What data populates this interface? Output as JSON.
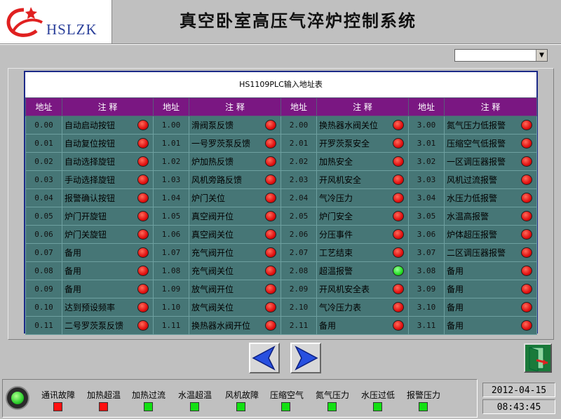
{
  "header": {
    "logo_text": "HSLZK",
    "title": "真空卧室高压气淬炉控制系统"
  },
  "dropdown": {
    "value": ""
  },
  "table": {
    "title": "HS1109PLC输入地址表",
    "headers": {
      "addr": "地址",
      "note": "注  释"
    },
    "columns": [
      [
        {
          "addr": "0.00",
          "note": "自动启动按钮",
          "state": "red"
        },
        {
          "addr": "0.01",
          "note": "自动复位按钮",
          "state": "red"
        },
        {
          "addr": "0.02",
          "note": "自动选择旋钮",
          "state": "red"
        },
        {
          "addr": "0.03",
          "note": "手动选择旋钮",
          "state": "red"
        },
        {
          "addr": "0.04",
          "note": "报警确认按钮",
          "state": "red"
        },
        {
          "addr": "0.05",
          "note": "炉门开旋钮",
          "state": "red"
        },
        {
          "addr": "0.06",
          "note": "炉门关旋钮",
          "state": "red"
        },
        {
          "addr": "0.07",
          "note": "备用",
          "state": "red"
        },
        {
          "addr": "0.08",
          "note": "备用",
          "state": "red"
        },
        {
          "addr": "0.09",
          "note": "备用",
          "state": "red"
        },
        {
          "addr": "0.10",
          "note": "达到预设频率",
          "state": "red"
        },
        {
          "addr": "0.11",
          "note": "二号罗茨泵反馈",
          "state": "red"
        }
      ],
      [
        {
          "addr": "1.00",
          "note": "滑阀泵反馈",
          "state": "red"
        },
        {
          "addr": "1.01",
          "note": "一号罗茨泵反馈",
          "state": "red"
        },
        {
          "addr": "1.02",
          "note": "炉加热反馈",
          "state": "red"
        },
        {
          "addr": "1.03",
          "note": "风机旁路反馈",
          "state": "red"
        },
        {
          "addr": "1.04",
          "note": "炉门关位",
          "state": "red"
        },
        {
          "addr": "1.05",
          "note": "真空阀开位",
          "state": "red"
        },
        {
          "addr": "1.06",
          "note": "真空阀关位",
          "state": "red"
        },
        {
          "addr": "1.07",
          "note": "充气阀开位",
          "state": "red"
        },
        {
          "addr": "1.08",
          "note": "充气阀关位",
          "state": "red"
        },
        {
          "addr": "1.09",
          "note": "放气阀开位",
          "state": "red"
        },
        {
          "addr": "1.10",
          "note": "放气阀关位",
          "state": "red"
        },
        {
          "addr": "1.11",
          "note": "换热器水阀开位",
          "state": "red"
        }
      ],
      [
        {
          "addr": "2.00",
          "note": "换热器水阀关位",
          "state": "red"
        },
        {
          "addr": "2.01",
          "note": "开罗茨泵安全",
          "state": "red"
        },
        {
          "addr": "2.02",
          "note": "加热安全",
          "state": "red"
        },
        {
          "addr": "2.03",
          "note": "开风机安全",
          "state": "red"
        },
        {
          "addr": "2.04",
          "note": "气冷压力",
          "state": "red"
        },
        {
          "addr": "2.05",
          "note": "炉门安全",
          "state": "red"
        },
        {
          "addr": "2.06",
          "note": "分压事件",
          "state": "red"
        },
        {
          "addr": "2.07",
          "note": "工艺结束",
          "state": "red"
        },
        {
          "addr": "2.08",
          "note": "超温报警",
          "state": "green"
        },
        {
          "addr": "2.09",
          "note": "开风机安全表",
          "state": "red"
        },
        {
          "addr": "2.10",
          "note": "气冷压力表",
          "state": "red"
        },
        {
          "addr": "2.11",
          "note": "备用",
          "state": "red"
        }
      ],
      [
        {
          "addr": "3.00",
          "note": "氮气压力低报警",
          "state": "red"
        },
        {
          "addr": "3.01",
          "note": "压缩空气低报警",
          "state": "red"
        },
        {
          "addr": "3.02",
          "note": "一区调压器报警",
          "state": "red"
        },
        {
          "addr": "3.03",
          "note": "风机过流报警",
          "state": "red"
        },
        {
          "addr": "3.04",
          "note": "水压力低报警",
          "state": "red"
        },
        {
          "addr": "3.05",
          "note": "水温高报警",
          "state": "red"
        },
        {
          "addr": "3.06",
          "note": "炉体超压报警",
          "state": "red"
        },
        {
          "addr": "3.07",
          "note": "二区调压器报警",
          "state": "red"
        },
        {
          "addr": "3.08",
          "note": "备用",
          "state": "red"
        },
        {
          "addr": "3.09",
          "note": "备用",
          "state": "red"
        },
        {
          "addr": "3.10",
          "note": "备用",
          "state": "red"
        },
        {
          "addr": "3.11",
          "note": "备用",
          "state": "red"
        }
      ]
    ]
  },
  "status_bar": {
    "alarms": [
      {
        "label": "通讯故障",
        "state": "red"
      },
      {
        "label": "加热超温",
        "state": "red"
      },
      {
        "label": "加热过流",
        "state": "green"
      },
      {
        "label": "水温超温",
        "state": "green"
      },
      {
        "label": "风机故障",
        "state": "green"
      },
      {
        "label": "压缩空气",
        "state": "green"
      },
      {
        "label": "氮气压力",
        "state": "green"
      },
      {
        "label": "水压过低",
        "state": "green"
      },
      {
        "label": "报警压力",
        "state": "green"
      }
    ],
    "date": "2012-04-15",
    "time": "08:43:45"
  },
  "colors": {
    "background": "#c0c0c0",
    "table_header": "#7a1782",
    "table_cell": "#467676",
    "indicator_red": "#e01010",
    "indicator_green": "#22dd22"
  },
  "icons": {
    "logo": "hslzk-swoosh-logo",
    "prev": "left-arrow-icon",
    "next": "right-arrow-icon",
    "exit": "exit-door-icon",
    "run": "run-indicator-icon"
  }
}
